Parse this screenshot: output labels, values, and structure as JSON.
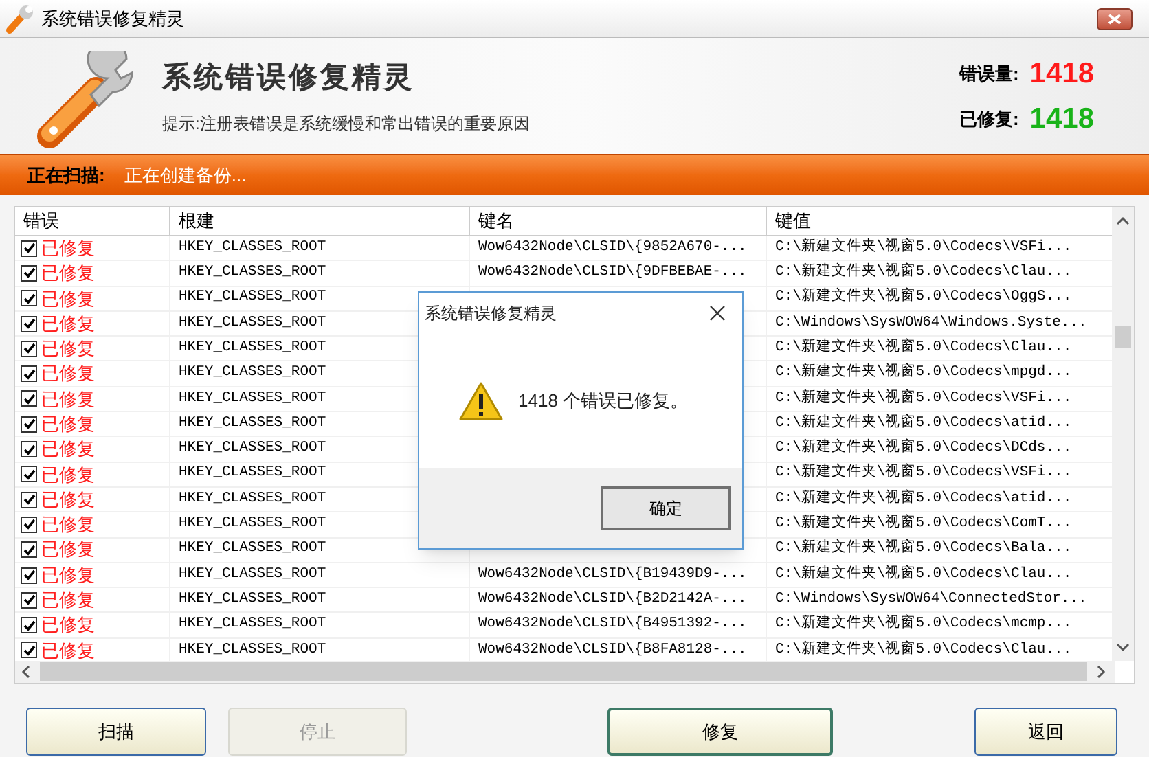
{
  "window": {
    "title": "系统错误修复精灵"
  },
  "header": {
    "title": "系统错误修复精灵",
    "hint": "提示:注册表错误是系统缓慢和常出错误的重要原因",
    "stats": [
      {
        "label": "错误量:",
        "value": "1418",
        "color": "#ff1a1a"
      },
      {
        "label": "已修复:",
        "value": "1418",
        "color": "#19b319"
      }
    ]
  },
  "status_bar": {
    "label": "正在扫描:",
    "text": "正在创建备份..."
  },
  "table": {
    "columns": [
      "错误",
      "根建",
      "键名",
      "键值"
    ],
    "rows": [
      {
        "checked": true,
        "status": "已修复",
        "root": "HKEY_CLASSES_ROOT",
        "key_name": "Wow6432Node\\CLSID\\{9852A670-...",
        "key_value": "C:\\新建文件夹\\视窗5.0\\Codecs\\VSFi..."
      },
      {
        "checked": true,
        "status": "已修复",
        "root": "HKEY_CLASSES_ROOT",
        "key_name": "Wow6432Node\\CLSID\\{9DFBEBAE-...",
        "key_value": "C:\\新建文件夹\\视窗5.0\\Codecs\\Clau..."
      },
      {
        "checked": true,
        "status": "已修复",
        "root": "HKEY_CLASSES_ROOT",
        "key_value": "C:\\新建文件夹\\视窗5.0\\Codecs\\OggS..."
      },
      {
        "checked": true,
        "status": "已修复",
        "root": "HKEY_CLASSES_ROOT",
        "key_value": "C:\\Windows\\SysWOW64\\Windows.Syste..."
      },
      {
        "checked": true,
        "status": "已修复",
        "root": "HKEY_CLASSES_ROOT",
        "key_value": "C:\\新建文件夹\\视窗5.0\\Codecs\\Clau..."
      },
      {
        "checked": true,
        "status": "已修复",
        "root": "HKEY_CLASSES_ROOT",
        "key_value": "C:\\新建文件夹\\视窗5.0\\Codecs\\mpgd..."
      },
      {
        "checked": true,
        "status": "已修复",
        "root": "HKEY_CLASSES_ROOT",
        "key_value": "C:\\新建文件夹\\视窗5.0\\Codecs\\VSFi..."
      },
      {
        "checked": true,
        "status": "已修复",
        "root": "HKEY_CLASSES_ROOT",
        "key_value": "C:\\新建文件夹\\视窗5.0\\Codecs\\atid..."
      },
      {
        "checked": true,
        "status": "已修复",
        "root": "HKEY_CLASSES_ROOT",
        "key_value": "C:\\新建文件夹\\视窗5.0\\Codecs\\DCds..."
      },
      {
        "checked": true,
        "status": "已修复",
        "root": "HKEY_CLASSES_ROOT",
        "key_value": "C:\\新建文件夹\\视窗5.0\\Codecs\\VSFi..."
      },
      {
        "checked": true,
        "status": "已修复",
        "root": "HKEY_CLASSES_ROOT",
        "key_value": "C:\\新建文件夹\\视窗5.0\\Codecs\\atid..."
      },
      {
        "checked": true,
        "status": "已修复",
        "root": "HKEY_CLASSES_ROOT",
        "key_value": "C:\\新建文件夹\\视窗5.0\\Codecs\\ComT..."
      },
      {
        "checked": true,
        "status": "已修复",
        "root": "HKEY_CLASSES_ROOT",
        "key_value": "C:\\新建文件夹\\视窗5.0\\Codecs\\Bala..."
      },
      {
        "checked": true,
        "status": "已修复",
        "root": "HKEY_CLASSES_ROOT",
        "key_name": "Wow6432Node\\CLSID\\{B19439D9-...",
        "key_value": "C:\\新建文件夹\\视窗5.0\\Codecs\\Clau..."
      },
      {
        "checked": true,
        "status": "已修复",
        "root": "HKEY_CLASSES_ROOT",
        "key_name": "Wow6432Node\\CLSID\\{B2D2142A-...",
        "key_value": "C:\\Windows\\SysWOW64\\ConnectedStor..."
      },
      {
        "checked": true,
        "status": "已修复",
        "root": "HKEY_CLASSES_ROOT",
        "key_name": "Wow6432Node\\CLSID\\{B4951392-...",
        "key_value": "C:\\新建文件夹\\视窗5.0\\Codecs\\mcmp..."
      },
      {
        "checked": true,
        "status": "已修复",
        "root": "HKEY_CLASSES_ROOT",
        "key_name": "Wow6432Node\\CLSID\\{B8FA8128-...",
        "key_value": "C:\\新建文件夹\\视窗5.0\\Codecs\\Clau..."
      }
    ]
  },
  "buttons": [
    {
      "label": "扫描",
      "disabled": false,
      "selected": false
    },
    {
      "label": "停止",
      "disabled": true,
      "selected": false
    },
    {
      "label": "修复",
      "disabled": false,
      "selected": true
    },
    {
      "label": "返回",
      "disabled": false,
      "selected": false
    }
  ],
  "dialog": {
    "title": "系统错误修复精灵",
    "message": "1418 个错误已修复。",
    "button": "确定"
  }
}
